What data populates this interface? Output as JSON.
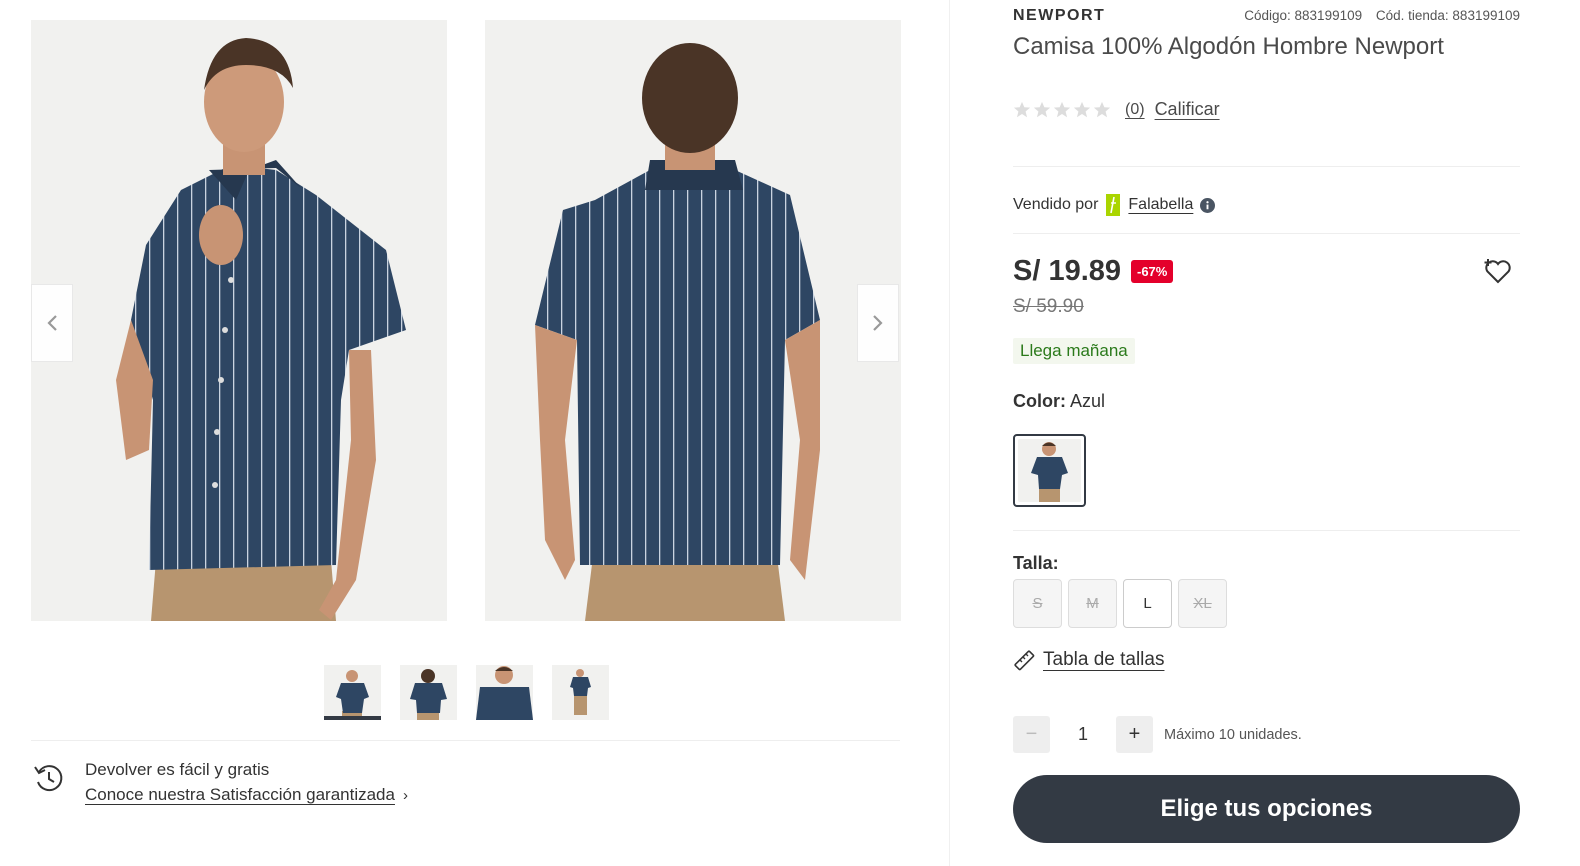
{
  "gallery": {
    "main_images": [
      "shirt-front-model",
      "shirt-back-model"
    ],
    "thumbnails": [
      "front",
      "back",
      "detail-front",
      "full-body"
    ],
    "active_thumbnail": 0,
    "returns": {
      "title": "Devolver es fácil y gratis",
      "link": "Conoce nuestra Satisfacción garantizada",
      "chevron": "›"
    }
  },
  "product": {
    "brand": "NEWPORT",
    "code": "Código: 883199109",
    "store_code": "Cód. tienda: 883199109",
    "title": "Camisa 100% Algodón Hombre Newport",
    "rating": {
      "stars": 0,
      "max": 5,
      "count": "(0)",
      "rate_link": "Calificar"
    },
    "seller": {
      "label": "Vendido por",
      "name": "Falabella"
    },
    "price": "S/ 19.89",
    "discount": "-67%",
    "old_price": "S/ 59.90",
    "delivery": "Llega mañana",
    "color": {
      "label": "Color:",
      "value": "Azul"
    },
    "size": {
      "label": "Talla:",
      "options": [
        {
          "label": "S",
          "available": false
        },
        {
          "label": "M",
          "available": false
        },
        {
          "label": "L",
          "available": true
        },
        {
          "label": "XL",
          "available": false
        }
      ]
    },
    "size_guide": "Tabla de tallas",
    "quantity": {
      "minus": "−",
      "value": "1",
      "plus": "+",
      "max_note": "Máximo 10 unidades."
    },
    "cta": "Elige tus opciones"
  },
  "colors": {
    "accent_dark": "#333a44",
    "discount_red": "#e4002b",
    "delivery_green": "#2b7a1b",
    "shirt_navy": "#2e4663",
    "falabella_green": "#aad500"
  }
}
